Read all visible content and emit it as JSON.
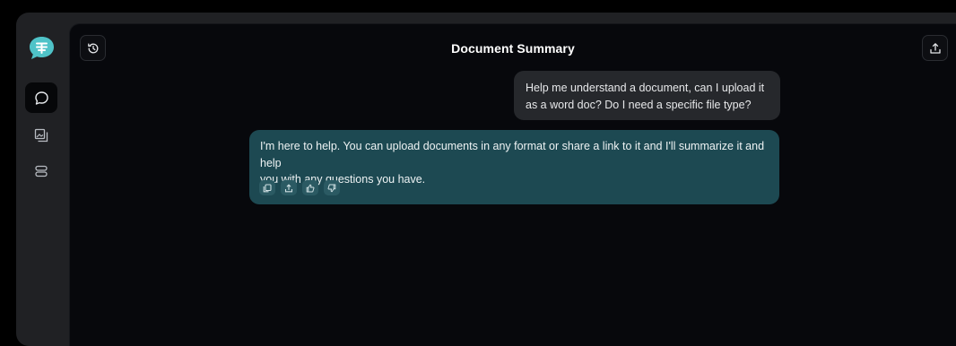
{
  "header": {
    "title": "Document Summary",
    "history_icon": "history-icon",
    "share_icon": "upload-icon"
  },
  "sidebar": {
    "logo_icon": "chat-logo-icon",
    "items": [
      {
        "name": "chat",
        "icon": "speech-bubble-icon",
        "active": true
      },
      {
        "name": "images",
        "icon": "image-gallery-icon",
        "active": false
      },
      {
        "name": "layers",
        "icon": "stacked-layers-icon",
        "active": false
      }
    ]
  },
  "messages": [
    {
      "role": "user",
      "line1": "Help me understand a document, can I upload it",
      "line2": "as a word doc? Do I need a specific file type?"
    },
    {
      "role": "assistant",
      "line1": "I'm here to help. You can upload documents in any format or share a link to it and I'll summarize it and help",
      "line2": "you with any questions you have.",
      "actions": [
        "copy-icon",
        "share-icon",
        "thumbs-up-icon",
        "thumbs-down-icon"
      ]
    }
  ],
  "colors": {
    "accent": "#4fc3c8",
    "assistant_bubble": "#1d4952",
    "user_bubble": "#26282c",
    "background": "#07080c"
  }
}
